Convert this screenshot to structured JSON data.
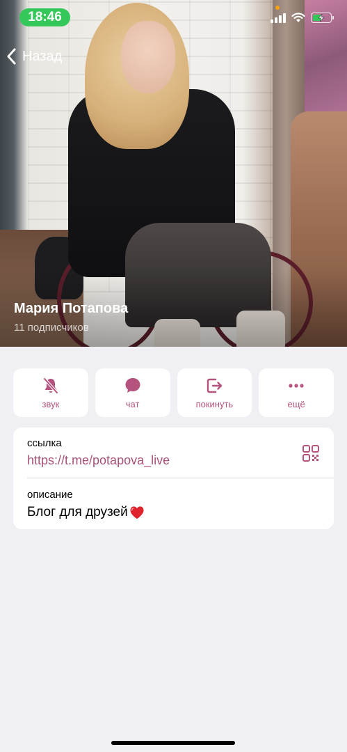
{
  "status_bar": {
    "time": "18:46",
    "icons": [
      "cellular-signal-icon",
      "wifi-icon",
      "battery-charging-icon"
    ]
  },
  "nav": {
    "back_label": "Назад"
  },
  "channel": {
    "name": "Мария Потапова",
    "subscribers": "11 подписчиков"
  },
  "actions": [
    {
      "label": "звук",
      "icon": "bell-slash-icon"
    },
    {
      "label": "чат",
      "icon": "chat-bubble-icon"
    },
    {
      "label": "покинуть",
      "icon": "leave-icon"
    },
    {
      "label": "ещё",
      "icon": "more-dots-icon"
    }
  ],
  "info": {
    "link_label": "ссылка",
    "link_value": "https://t.me/potapova_live",
    "description_label": "описание",
    "description_value": "Блог для друзей",
    "description_emoji": "red-heart-icon"
  },
  "colors": {
    "accent": "#b5527d",
    "link": "#a8527a",
    "status_green": "#34c759",
    "background": "#efeff4"
  }
}
